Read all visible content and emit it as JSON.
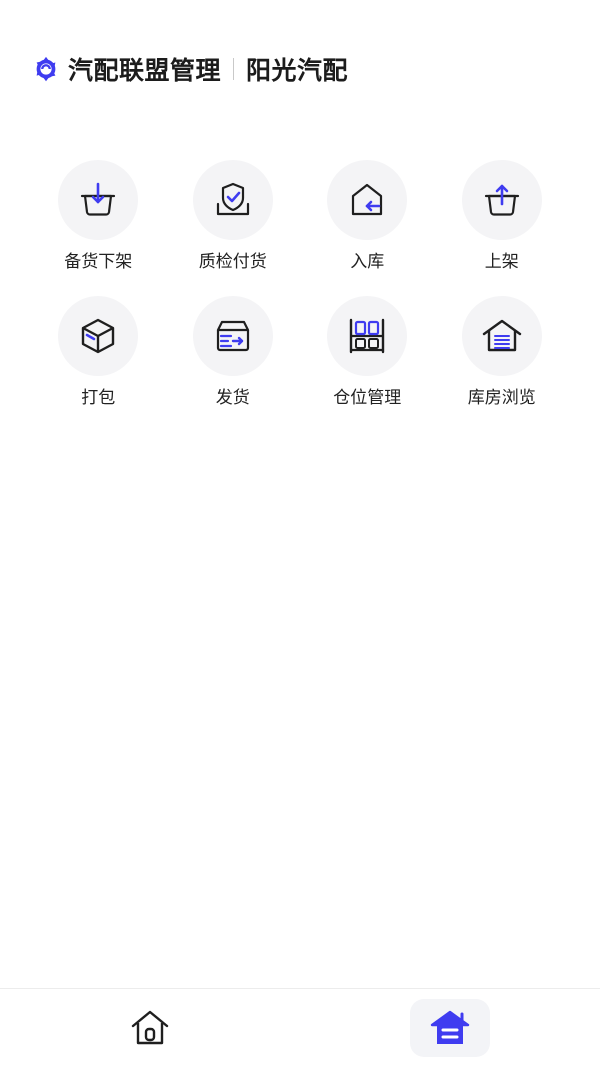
{
  "header": {
    "logo_icon": "gear-logo-icon",
    "app_title": "汽配联盟管理",
    "company_name": "阳光汽配"
  },
  "colors": {
    "accent": "#3f3cf0",
    "icon_stroke": "#1f1f1f",
    "tile_bg": "#f4f4f6"
  },
  "menu": {
    "items": [
      {
        "label": "备货下架",
        "icon": "unload-basket-icon"
      },
      {
        "label": "质检付货",
        "icon": "quality-check-shield-icon"
      },
      {
        "label": "入库",
        "icon": "inbound-house-icon"
      },
      {
        "label": "上架",
        "icon": "shelve-basket-icon"
      },
      {
        "label": "打包",
        "icon": "package-box-icon"
      },
      {
        "label": "发货",
        "icon": "shipping-box-icon"
      },
      {
        "label": "仓位管理",
        "icon": "storage-rack-icon"
      },
      {
        "label": "库房浏览",
        "icon": "warehouse-list-icon"
      }
    ]
  },
  "tabbar": {
    "tabs": [
      {
        "icon": "home-icon",
        "active": false
      },
      {
        "icon": "warehouse-icon",
        "active": true
      }
    ]
  }
}
